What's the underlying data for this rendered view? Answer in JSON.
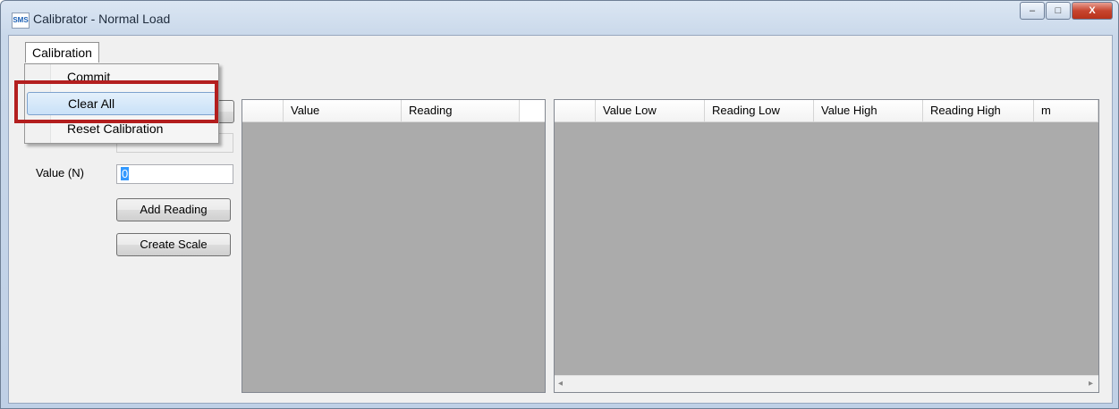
{
  "window": {
    "app_icon_text": "SMS",
    "title": "Calibrator - Normal Load",
    "minimize": "–",
    "maximize": "□",
    "close": "X"
  },
  "menu": {
    "calibration_label": "Calibration",
    "items": [
      "Commit",
      "Clear All",
      "Reset Calibration"
    ]
  },
  "form": {
    "value_label": "Value (N)",
    "value_input": "0",
    "add_reading": "Add Reading",
    "create_scale": "Create Scale"
  },
  "readings_table": {
    "columns": [
      "",
      "Value",
      "Reading"
    ]
  },
  "scale_table": {
    "columns": [
      "",
      "Value Low",
      "Reading Low",
      "Value High",
      "Reading High",
      "m"
    ],
    "scroll_left": "◂",
    "scroll_right": "▸"
  }
}
